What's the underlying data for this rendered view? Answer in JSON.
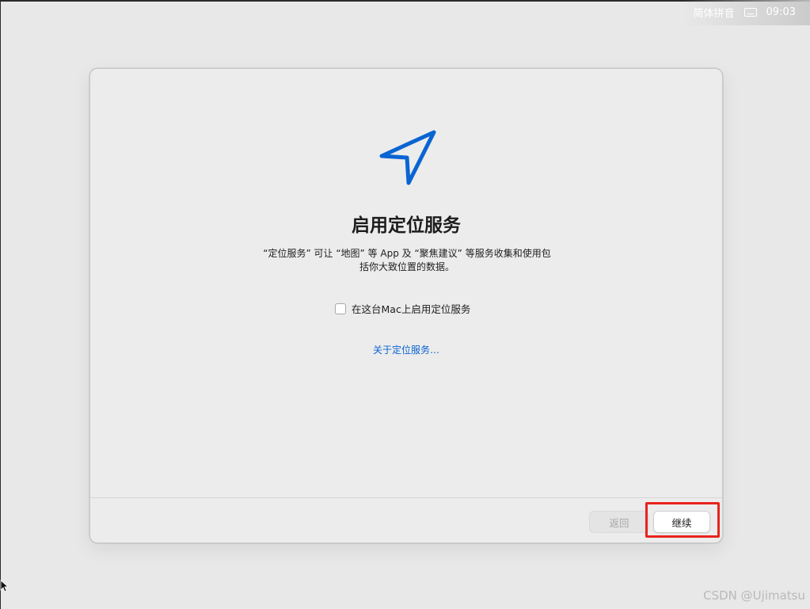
{
  "menubar": {
    "input_method": "简体拼音",
    "keyboard_icon": "keyboard-icon",
    "time": "09:03"
  },
  "dialog": {
    "icon": "location-arrow-icon",
    "title": "启用定位服务",
    "description_line1": "“定位服务” 可让 “地图” 等 App 及 “聚焦建议” 等服务收集和使用包",
    "description_line2": "括你大致位置的数据。",
    "checkbox_label": "在这台Mac上启用定位服务",
    "checkbox_checked": false,
    "about_link": "关于定位服务…",
    "back_button": "返回",
    "continue_button": "继续"
  },
  "watermark": "CSDN @Ujimatsu",
  "colors": {
    "accent": "#0a64d2",
    "highlight": "#e8231d"
  }
}
